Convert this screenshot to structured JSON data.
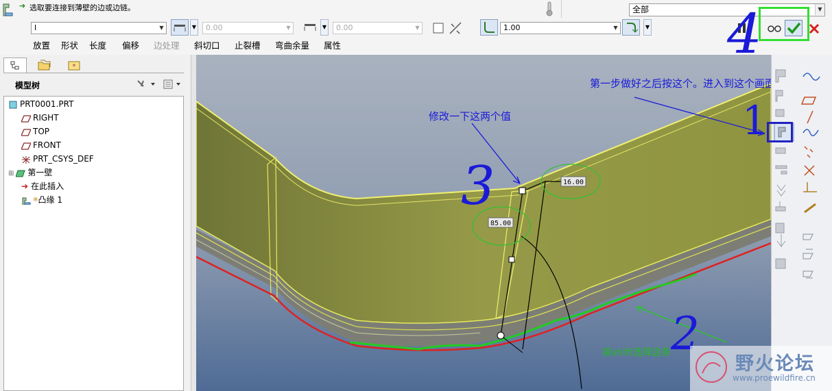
{
  "message": {
    "text": "选取要连接到薄壁的边或边链。"
  },
  "filter": {
    "value": "全部"
  },
  "dashboard": {
    "shape_select": "I",
    "length1": "0.00",
    "length2": "0.00",
    "thickness": "1.00",
    "tabs": [
      "放置",
      "形状",
      "长度",
      "偏移",
      "边处理",
      "斜切口",
      "止裂槽",
      "弯曲余量",
      "属性"
    ]
  },
  "model_tree": {
    "title": "模型树",
    "items": [
      "PRT0001.PRT",
      "RIGHT",
      "TOP",
      "FRONT",
      "PRT_CSYS_DEF",
      "第一壁",
      "在此插入",
      "凸缘 1"
    ]
  },
  "dims": {
    "d1": "16.00",
    "d2": "85.00"
  },
  "annotations": {
    "step1": "第一步做好之后按这个。进入到这个画面",
    "modify": "修改一下这两个值",
    "shift": "接shift选择这条",
    "num1": "1",
    "num2": "2",
    "num3": "3",
    "num4": "4"
  },
  "watermark": {
    "brand": "野火论坛",
    "url": "www.proewildfire.cn"
  },
  "colors": {
    "annotation_blue": "#1a1ad8",
    "annotation_green": "#22bb22",
    "part_yellow": "#8f9440",
    "edge_red": "#e02020"
  }
}
